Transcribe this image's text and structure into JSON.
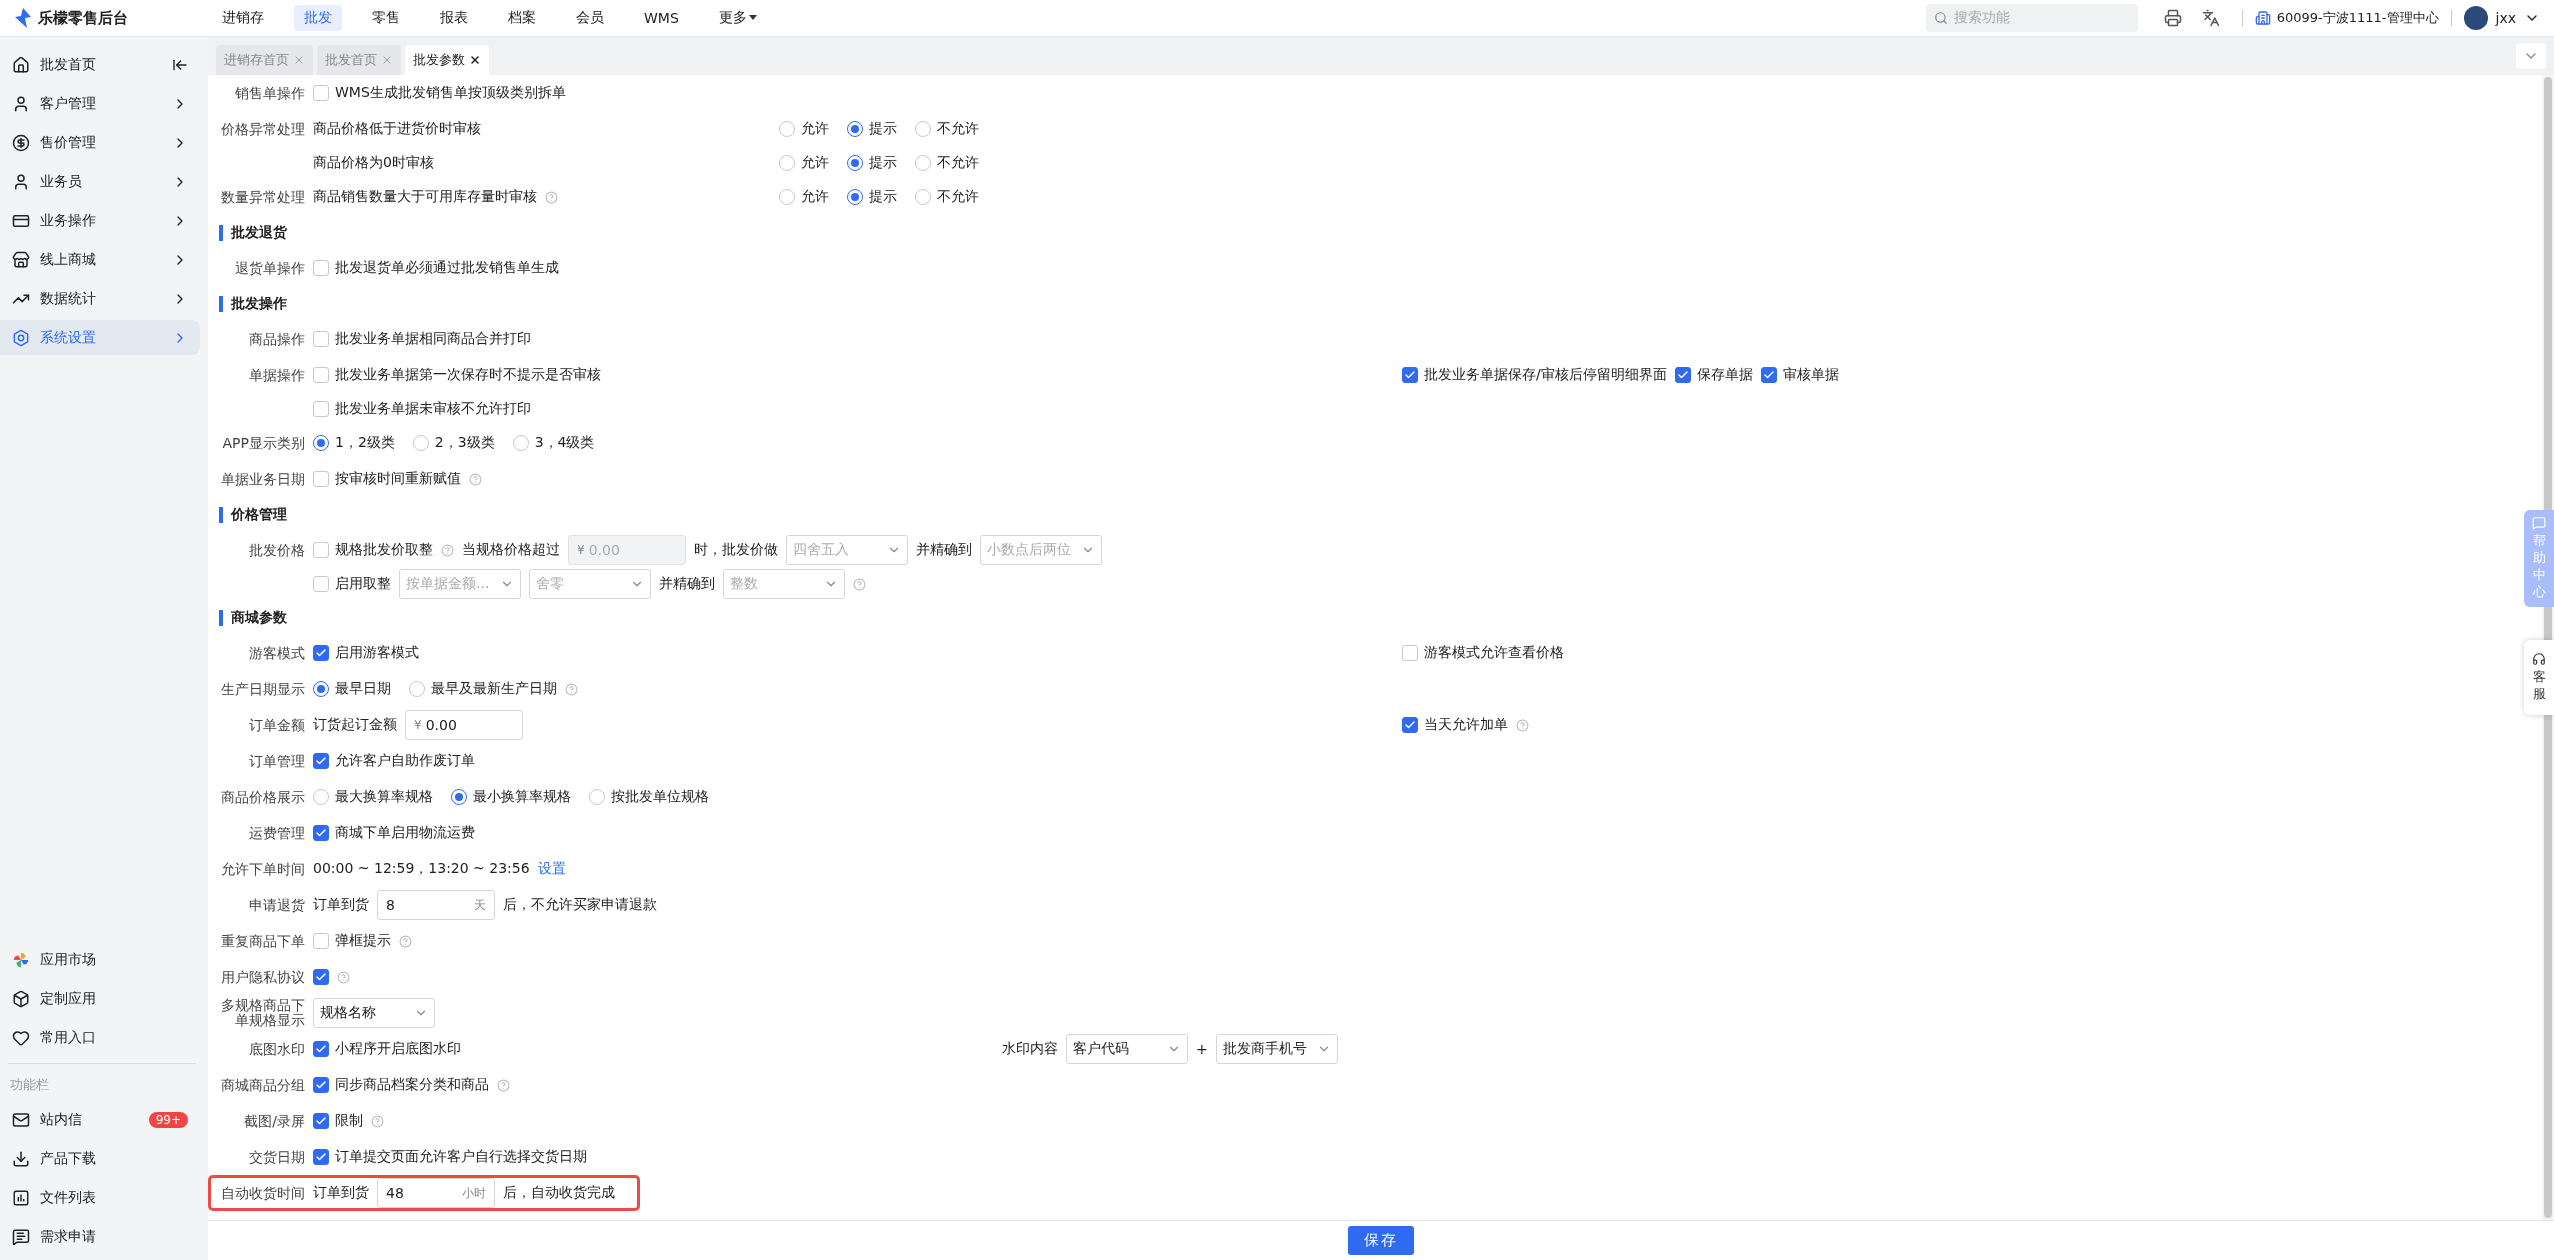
{
  "app": {
    "name": "乐檬零售后台"
  },
  "nav": [
    {
      "label": "进销存",
      "selected": false,
      "kind": "link"
    },
    {
      "label": "批发",
      "selected": true,
      "kind": "link"
    },
    {
      "label": "零售",
      "selected": false,
      "kind": "link"
    },
    {
      "label": "报表",
      "selected": false,
      "kind": "link"
    },
    {
      "label": "档案",
      "selected": false,
      "kind": "link"
    },
    {
      "label": "会员",
      "selected": false,
      "kind": "link"
    },
    {
      "label": "WMS",
      "selected": false,
      "kind": "link"
    },
    {
      "label": "更多",
      "selected": false,
      "kind": "menu"
    }
  ],
  "search": {
    "placeholder": "搜索功能"
  },
  "org": "60099-宁波1111-管理中心",
  "user": "jxx",
  "tabs": [
    {
      "label": "进销存首页",
      "selected": false
    },
    {
      "label": "批发首页",
      "selected": false
    },
    {
      "label": "批发参数",
      "selected": true
    }
  ],
  "sidebar": {
    "items": [
      {
        "label": "批发首页",
        "selected": false
      },
      {
        "label": "客户管理",
        "selected": false
      },
      {
        "label": "售价管理",
        "selected": false
      },
      {
        "label": "业务员",
        "selected": false
      },
      {
        "label": "业务操作",
        "selected": false
      },
      {
        "label": "线上商城",
        "selected": false
      },
      {
        "label": "数据统计",
        "selected": false
      },
      {
        "label": "系统设置",
        "selected": true
      }
    ],
    "shortcuts": [
      {
        "label": "应用市场"
      },
      {
        "label": "定制应用"
      },
      {
        "label": "常用入口"
      }
    ],
    "tools_title": "功能栏",
    "tools": [
      {
        "label": "站内信",
        "badge": "99+"
      },
      {
        "label": "产品下载"
      },
      {
        "label": "文件列表"
      },
      {
        "label": "需求申请"
      }
    ]
  },
  "form": {
    "blocks": [
      {
        "kind": "row",
        "label": "销售单操作",
        "main": [
          {
            "kind": "checkbox",
            "label": "WMS生成批发销售单按顶级类别拆单",
            "checked": false
          }
        ]
      },
      {
        "kind": "row",
        "label": "价格异常处理",
        "main": [
          {
            "kind": "text",
            "text": "商品价格低于进货价时审核"
          }
        ],
        "mid": [
          {
            "kind": "radios",
            "options": [
              {
                "label": "允许",
                "selected": false
              },
              {
                "label": "提示",
                "selected": true
              },
              {
                "label": "不允许",
                "selected": false
              }
            ]
          }
        ]
      },
      {
        "kind": "row",
        "main": [
          {
            "kind": "text",
            "text": "商品价格为0时审核"
          }
        ],
        "mid": [
          {
            "kind": "radios",
            "options": [
              {
                "label": "允许",
                "selected": false
              },
              {
                "label": "提示",
                "selected": true
              },
              {
                "label": "不允许",
                "selected": false
              }
            ]
          }
        ]
      },
      {
        "kind": "row",
        "label": "数量异常处理",
        "main": [
          {
            "kind": "text",
            "text": "商品销售数量大于可用库存量时审核"
          },
          {
            "kind": "help"
          }
        ],
        "mid": [
          {
            "kind": "radios",
            "options": [
              {
                "label": "允许",
                "selected": false
              },
              {
                "label": "提示",
                "selected": true
              },
              {
                "label": "不允许",
                "selected": false
              }
            ]
          }
        ]
      },
      {
        "kind": "section",
        "title": "批发退货"
      },
      {
        "kind": "row",
        "label": "退货单操作",
        "main": [
          {
            "kind": "checkbox",
            "label": "批发退货单必须通过批发销售单生成",
            "checked": false
          }
        ]
      },
      {
        "kind": "section",
        "title": "批发操作"
      },
      {
        "kind": "row",
        "label": "商品操作",
        "main": [
          {
            "kind": "checkbox",
            "label": "批发业务单据相同商品合并打印",
            "checked": false
          }
        ]
      },
      {
        "kind": "row",
        "label": "单据操作",
        "main": [
          {
            "kind": "checkbox",
            "label": "批发业务单据第一次保存时不提示是否审核",
            "checked": false
          }
        ],
        "right": [
          {
            "kind": "checkbox",
            "label": "批发业务单据保存/审核后停留明细界面",
            "checked": true
          },
          {
            "kind": "checkbox",
            "label": "保存单据",
            "checked": true
          },
          {
            "kind": "checkbox",
            "label": "审核单据",
            "checked": true
          }
        ]
      },
      {
        "kind": "row",
        "main": [
          {
            "kind": "checkbox",
            "label": "批发业务单据未审核不允许打印",
            "checked": false
          }
        ]
      },
      {
        "kind": "row",
        "label": "APP显示类别",
        "main": [
          {
            "kind": "radios",
            "options": [
              {
                "label": "1，2级类",
                "selected": true
              },
              {
                "label": "2，3级类",
                "selected": false
              },
              {
                "label": "3，4级类",
                "selected": false
              }
            ]
          }
        ]
      },
      {
        "kind": "row",
        "label": "单据业务日期",
        "main": [
          {
            "kind": "checkbox",
            "label": "按审核时间重新赋值",
            "checked": false
          },
          {
            "kind": "help"
          }
        ]
      },
      {
        "kind": "section",
        "title": "价格管理"
      },
      {
        "kind": "row",
        "label": "批发价格",
        "main": [
          {
            "kind": "checkbox",
            "label": "规格批发价取整",
            "checked": false
          },
          {
            "kind": "help"
          },
          {
            "kind": "text",
            "text": "当规格价格超过"
          },
          {
            "kind": "input",
            "prefix": "¥",
            "placeholder": "0.00",
            "disabled": true
          },
          {
            "kind": "text",
            "text": "时，批发价做"
          },
          {
            "kind": "select",
            "value": "四舍五入",
            "disabled": true
          },
          {
            "kind": "text",
            "text": "并精确到"
          },
          {
            "kind": "select",
            "value": "小数点后两位",
            "disabled": true
          }
        ]
      },
      {
        "kind": "row",
        "main": [
          {
            "kind": "checkbox",
            "label": "启用取整",
            "checked": false
          },
          {
            "kind": "select",
            "value": "按单据金额...",
            "disabled": true
          },
          {
            "kind": "select",
            "value": "舍零",
            "disabled": true
          },
          {
            "kind": "text",
            "text": "并精确到"
          },
          {
            "kind": "select",
            "value": "整数",
            "disabled": true
          },
          {
            "kind": "help"
          }
        ]
      },
      {
        "kind": "section",
        "title": "商城参数"
      },
      {
        "kind": "row",
        "label": "游客模式",
        "main": [
          {
            "kind": "checkbox",
            "label": "启用游客模式",
            "checked": true
          }
        ],
        "right": [
          {
            "kind": "checkbox",
            "label": "游客模式允许查看价格",
            "checked": false
          }
        ]
      },
      {
        "kind": "row",
        "label": "生产日期显示",
        "main": [
          {
            "kind": "radios",
            "options": [
              {
                "label": "最早日期",
                "selected": true
              },
              {
                "label": "最早及最新生产日期",
                "selected": false
              }
            ]
          },
          {
            "kind": "help"
          }
        ]
      },
      {
        "kind": "row",
        "label": "订单金额",
        "main": [
          {
            "kind": "text",
            "text": "订货起订金额"
          },
          {
            "kind": "input",
            "prefix": "¥",
            "value": "0.00",
            "disabled": false
          }
        ],
        "right": [
          {
            "kind": "checkbox",
            "label": "当天允许加单",
            "checked": true
          },
          {
            "kind": "help"
          }
        ]
      },
      {
        "kind": "row",
        "label": "订单管理",
        "main": [
          {
            "kind": "checkbox",
            "label": "允许客户自助作废订单",
            "checked": true
          }
        ]
      },
      {
        "kind": "row",
        "label": "商品价格展示",
        "main": [
          {
            "kind": "radios",
            "options": [
              {
                "label": "最大换算率规格",
                "selected": false
              },
              {
                "label": "最小换算率规格",
                "selected": true
              },
              {
                "label": "按批发单位规格",
                "selected": false
              }
            ]
          }
        ]
      },
      {
        "kind": "row",
        "label": "运费管理",
        "main": [
          {
            "kind": "checkbox",
            "label": "商城下单启用物流运费",
            "checked": true
          }
        ]
      },
      {
        "kind": "row",
        "label": "允许下单时间",
        "main": [
          {
            "kind": "text",
            "text": "00:00 ~ 12:59，13:20 ~ 23:56"
          },
          {
            "kind": "link",
            "text": "设置"
          }
        ]
      },
      {
        "kind": "row",
        "label": "申请退货",
        "main": [
          {
            "kind": "text",
            "text": "订单到货"
          },
          {
            "kind": "input",
            "value": "8",
            "suffix": "天",
            "disabled": false
          },
          {
            "kind": "text",
            "text": "后，不允许买家申请退款"
          }
        ]
      },
      {
        "kind": "row",
        "label": "重复商品下单",
        "main": [
          {
            "kind": "checkbox",
            "label": "弹框提示",
            "checked": false
          },
          {
            "kind": "help"
          }
        ]
      },
      {
        "kind": "row",
        "label": "用户隐私协议",
        "main": [
          {
            "kind": "checkbox",
            "checked": true
          },
          {
            "kind": "help"
          }
        ]
      },
      {
        "kind": "row",
        "label": "多规格商品下单规格显示",
        "main": [
          {
            "kind": "select",
            "value": "规格名称",
            "disabled": false
          }
        ]
      },
      {
        "kind": "row",
        "label": "底图水印",
        "main": [
          {
            "kind": "checkbox",
            "label": "小程序开启底图水印",
            "checked": true
          }
        ],
        "side": [
          {
            "kind": "text",
            "text": "水印内容"
          },
          {
            "kind": "select",
            "value": "客户代码",
            "disabled": false
          },
          {
            "kind": "text",
            "text": "+"
          },
          {
            "kind": "select",
            "value": "批发商手机号",
            "disabled": false
          }
        ]
      },
      {
        "kind": "row",
        "label": "商城商品分组",
        "main": [
          {
            "kind": "checkbox",
            "label": "同步商品档案分类和商品",
            "checked": true
          },
          {
            "kind": "help"
          }
        ]
      },
      {
        "kind": "row",
        "label": "截图/录屏",
        "main": [
          {
            "kind": "checkbox",
            "label": "限制",
            "checked": true
          },
          {
            "kind": "help"
          }
        ]
      },
      {
        "kind": "row",
        "label": "交货日期",
        "main": [
          {
            "kind": "checkbox",
            "label": "订单提交页面允许客户自行选择交货日期",
            "checked": true
          }
        ]
      },
      {
        "kind": "row",
        "label": "自动收货时间",
        "highlighted": true,
        "main": [
          {
            "kind": "text",
            "text": "订单到货"
          },
          {
            "kind": "input",
            "value": "48",
            "suffix": "小时",
            "disabled": false
          },
          {
            "kind": "text",
            "text": "后，自动收货完成"
          }
        ]
      }
    ]
  },
  "save_button": "保存",
  "floats": {
    "help": "帮助中心",
    "service": "客服"
  }
}
